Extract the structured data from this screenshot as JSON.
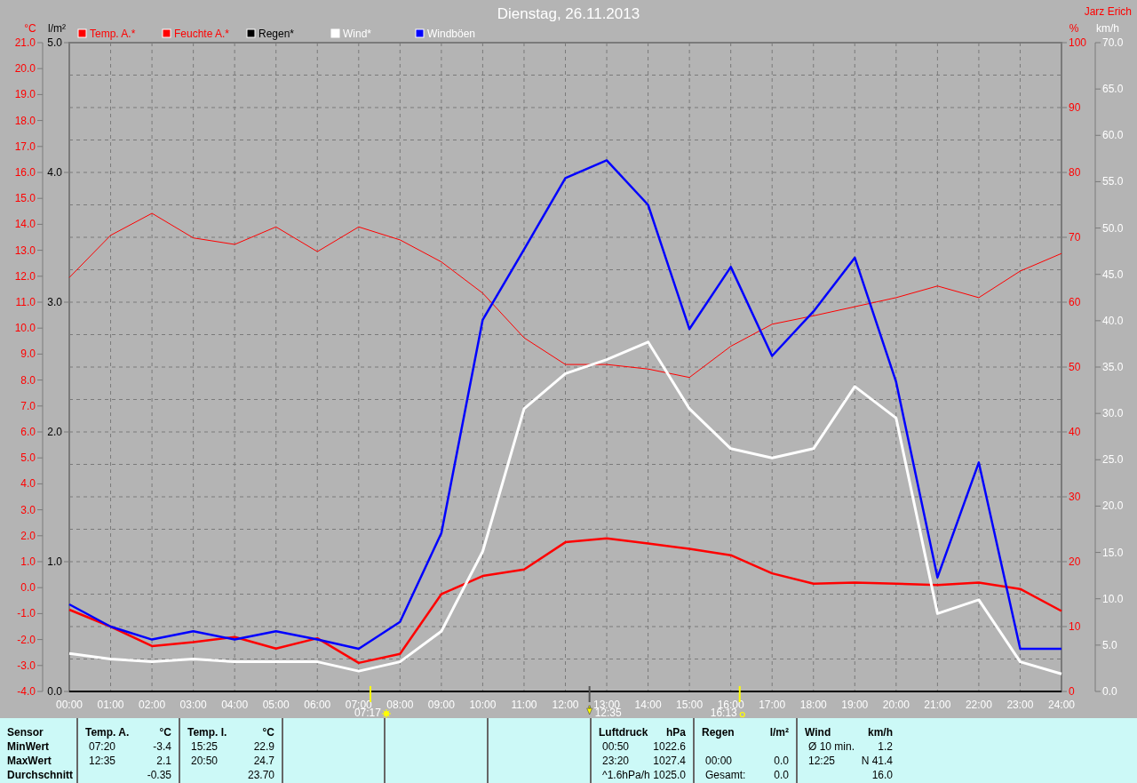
{
  "author": "Jarz Erich",
  "chart_data": {
    "type": "line",
    "title": "Dienstag, 26.11.2013",
    "xlim": [
      0,
      24
    ],
    "x": [
      0,
      1,
      2,
      3,
      4,
      5,
      6,
      7,
      8,
      9,
      10,
      11,
      12,
      13,
      14,
      15,
      16,
      17,
      18,
      19,
      20,
      21,
      22,
      23,
      24
    ],
    "xticks": [
      {
        "value": 0,
        "label": "00:00"
      },
      {
        "value": 1,
        "label": "01:00"
      },
      {
        "value": 2,
        "label": "02:00"
      },
      {
        "value": 3,
        "label": "03:00"
      },
      {
        "value": 4,
        "label": "04:00"
      },
      {
        "value": 5,
        "label": "05:00"
      },
      {
        "value": 6,
        "label": "06:00"
      },
      {
        "value": 7,
        "label": "07:00"
      },
      {
        "value": 8,
        "label": "08:00"
      },
      {
        "value": 9,
        "label": "09:00"
      },
      {
        "value": 10,
        "label": "10:00"
      },
      {
        "value": 11,
        "label": "11:00"
      },
      {
        "value": 12,
        "label": "12:00"
      },
      {
        "value": 13,
        "label": "13:00"
      },
      {
        "value": 14,
        "label": "14:00"
      },
      {
        "value": 15,
        "label": "15:00"
      },
      {
        "value": 16,
        "label": "16:00"
      },
      {
        "value": 17,
        "label": "17:00"
      },
      {
        "value": 18,
        "label": "18:00"
      },
      {
        "value": 19,
        "label": "19:00"
      },
      {
        "value": 20,
        "label": "20:00"
      },
      {
        "value": 21,
        "label": "21:00"
      },
      {
        "value": 22,
        "label": "22:00"
      },
      {
        "value": 23,
        "label": "23:00"
      },
      {
        "value": 24,
        "label": "24:00"
      }
    ],
    "ylabel": "°C",
    "ylim": [
      -4,
      21
    ],
    "yticks": [
      {
        "value": 21,
        "label": "21.0"
      },
      {
        "value": 20,
        "label": "20.0"
      },
      {
        "value": 19,
        "label": "19.0"
      },
      {
        "value": 18,
        "label": "18.0"
      },
      {
        "value": 17,
        "label": "17.0"
      },
      {
        "value": 16,
        "label": "16.0"
      },
      {
        "value": 15,
        "label": "15.0"
      },
      {
        "value": 14,
        "label": "14.0"
      },
      {
        "value": 13,
        "label": "13.0"
      },
      {
        "value": 12,
        "label": "12.0"
      },
      {
        "value": 11,
        "label": "11.0"
      },
      {
        "value": 10,
        "label": "10.0"
      },
      {
        "value": 9,
        "label": "9.0"
      },
      {
        "value": 8,
        "label": "8.0"
      },
      {
        "value": 7,
        "label": "7.0"
      },
      {
        "value": 6,
        "label": "6.0"
      },
      {
        "value": 5,
        "label": "5.0"
      },
      {
        "value": 4,
        "label": "4.0"
      },
      {
        "value": 3,
        "label": "3.0"
      },
      {
        "value": 2,
        "label": "2.0"
      },
      {
        "value": 1,
        "label": "1.0"
      },
      {
        "value": 0,
        "label": "0.0"
      },
      {
        "value": -1,
        "label": "-1.0"
      },
      {
        "value": -2,
        "label": "-2.0"
      },
      {
        "value": -3,
        "label": "-3.0"
      },
      {
        "value": -4,
        "label": "-4.0"
      }
    ],
    "y2label": "%",
    "y2lim": [
      0,
      100
    ],
    "y2ticks": [
      {
        "value": 100,
        "label": "100"
      },
      {
        "value": 90,
        "label": "90"
      },
      {
        "value": 80,
        "label": "80"
      },
      {
        "value": 70,
        "label": "70"
      },
      {
        "value": 60,
        "label": "60"
      },
      {
        "value": 50,
        "label": "50"
      },
      {
        "value": 40,
        "label": "40"
      },
      {
        "value": 30,
        "label": "30"
      },
      {
        "value": 20,
        "label": "20"
      },
      {
        "value": 10,
        "label": "10"
      },
      {
        "value": 0,
        "label": "0"
      }
    ],
    "y3label": "km/h",
    "y3lim": [
      0,
      70
    ],
    "y3ticks": [
      {
        "value": 70,
        "label": "70.0"
      },
      {
        "value": 65,
        "label": "65.0"
      },
      {
        "value": 60,
        "label": "60.0"
      },
      {
        "value": 55,
        "label": "55.0"
      },
      {
        "value": 50,
        "label": "50.0"
      },
      {
        "value": 45,
        "label": "45.0"
      },
      {
        "value": 40,
        "label": "40.0"
      },
      {
        "value": 35,
        "label": "35.0"
      },
      {
        "value": 30,
        "label": "30.0"
      },
      {
        "value": 25,
        "label": "25.0"
      },
      {
        "value": 20,
        "label": "20.0"
      },
      {
        "value": 15,
        "label": "15.0"
      },
      {
        "value": 10,
        "label": "10.0"
      },
      {
        "value": 5,
        "label": "5.0"
      },
      {
        "value": 0,
        "label": "0.0"
      }
    ],
    "series": [
      {
        "name": "Temp. A.*",
        "color": "#ff0000",
        "values": [
          -0.85,
          -1.5,
          -2.25,
          -2.1,
          -1.9,
          -2.35,
          -1.95,
          -2.9,
          -2.55,
          -0.25,
          0.45,
          0.7,
          1.75,
          1.9,
          1.7,
          1.5,
          1.25,
          0.55,
          0.15,
          0.2,
          0.15,
          0.1,
          0.2,
          -0.05,
          -0.9
        ]
      },
      {
        "name": "Feuchte A.*",
        "color": "#ff0000",
        "axis": "y2",
        "values": [
          63.8,
          70.3,
          73.7,
          69.9,
          68.9,
          71.6,
          67.8,
          71.6,
          69.6,
          66.2,
          61.4,
          54.5,
          50.4,
          50.4,
          49.7,
          48.4,
          53.2,
          56.6,
          57.9,
          59.3,
          60.7,
          62.5,
          60.7,
          64.8,
          67.5
        ]
      },
      {
        "name": "Regen*",
        "color": "#000000",
        "axis": "y2",
        "values": [
          0,
          0,
          0,
          0,
          0,
          0,
          0,
          0,
          0,
          0,
          0,
          0,
          0,
          0,
          0,
          0,
          0,
          0,
          0,
          0,
          0,
          0,
          0,
          0,
          0
        ]
      },
      {
        "name": "Wind*",
        "color": "#ffffff",
        "axis": "y3",
        "values": [
          4.1,
          3.5,
          3.2,
          3.5,
          3.2,
          3.2,
          3.2,
          2.2,
          3.2,
          6.5,
          15.1,
          30.5,
          34.3,
          35.8,
          37.7,
          30.5,
          26.2,
          25.2,
          26.2,
          32.9,
          29.5,
          8.4,
          9.9,
          3.2,
          1.9
        ]
      },
      {
        "name": "Windböen",
        "color": "#0000ff",
        "axis": "y3",
        "values": [
          9.4,
          7.0,
          5.6,
          6.5,
          5.6,
          6.5,
          5.6,
          4.6,
          7.5,
          17.1,
          40.1,
          47.7,
          55.4,
          57.3,
          52.5,
          39.1,
          45.8,
          36.2,
          41.0,
          46.8,
          33.4,
          12.3,
          24.7,
          4.6,
          4.6
        ]
      }
    ],
    "annotations": [
      "07:17",
      "12:35",
      "16:13"
    ],
    "grid": true,
    "legend": "top"
  },
  "rain_axis": {
    "unit": "l/m²",
    "ticks": [
      "5.0",
      "4.0",
      "3.0",
      "2.0",
      "1.0",
      "0.0"
    ]
  },
  "table": {
    "row_labels": [
      "Sensor",
      "MinWert",
      "MaxWert",
      "Durchschnitt"
    ],
    "columns": [
      {
        "kind": "sensor",
        "name": "Temp. A.",
        "unit": "°C",
        "rows": [
          {
            "time": "07:20",
            "value": "-3.4"
          },
          {
            "time": "12:35",
            "value": "2.1"
          },
          {
            "value": "-0.35"
          }
        ]
      },
      {
        "kind": "sensor",
        "name": "Temp. I.",
        "unit": "°C",
        "rows": [
          {
            "time": "15:25",
            "value": "22.9"
          },
          {
            "time": "20:50",
            "value": "24.7"
          },
          {
            "value": "23.70"
          }
        ]
      },
      {
        "kind": "blank"
      },
      {
        "kind": "blank"
      },
      {
        "kind": "blank"
      },
      {
        "kind": "sensor",
        "name": "Luftdruck",
        "unit": "hPa",
        "rows": [
          {
            "time": "00:50",
            "value": "1022.6"
          },
          {
            "time": "23:20",
            "value": "1027.4"
          },
          {
            "time": "^1.6hPa/h",
            "value": "1025.0"
          }
        ]
      },
      {
        "kind": "sensor",
        "name": "Regen",
        "unit": "l/m²",
        "rows": [
          {},
          {
            "time": "00:00",
            "value": "0.0"
          },
          {
            "time": "Gesamt:",
            "value": "0.0"
          }
        ]
      },
      {
        "kind": "sensor",
        "name": "Wind",
        "unit": "km/h",
        "rows": [
          {
            "time": "Ø 10 min.",
            "value": "1.2"
          },
          {
            "time": "12:25",
            "value": "N 41.4"
          },
          {
            "value": "16.0"
          }
        ]
      }
    ]
  }
}
